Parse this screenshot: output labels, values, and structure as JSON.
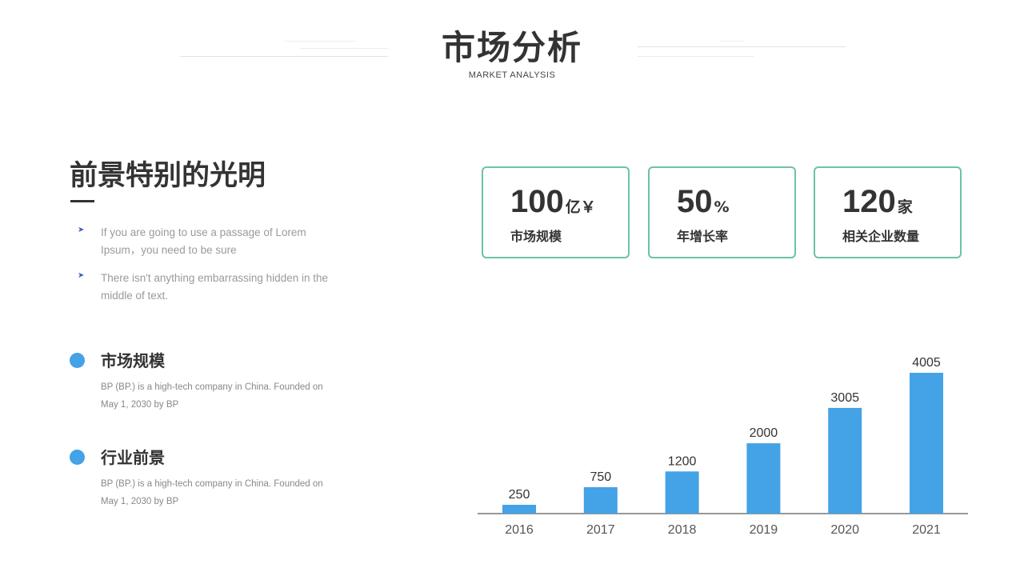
{
  "header": {
    "title": "市场分析",
    "subtitle": "MARKET ANALYSIS"
  },
  "left": {
    "section_title": "前景特别的光明",
    "bullets": [
      "If you are going to use a passage of Lorem Ipsum，you need to be sure",
      "There isn't anything embarrassing hidden in the middle  of text."
    ],
    "items": [
      {
        "title": "市场规模",
        "desc": "BP (BP.) is a high-tech company in China. Founded on May  1, 2030 by BP"
      },
      {
        "title": "行业前景",
        "desc": "BP (BP.) is a high-tech company in China. Founded on May  1, 2030 by BP"
      }
    ]
  },
  "stats": [
    {
      "value": "100",
      "unit": "亿￥",
      "label": "市场规模"
    },
    {
      "value": "50",
      "unit": "%",
      "label": "年增长率"
    },
    {
      "value": "120",
      "unit": "家",
      "label": "相关企业数量"
    }
  ],
  "colors": {
    "bar": "#44a2e6",
    "accent_border": "#6cc4a4",
    "dot": "#44a2e6",
    "text_dark": "#333333",
    "text_muted": "#9a9a9a"
  },
  "icons": {
    "bullet": "arrowhead-icon",
    "item": "circle-dot-icon"
  },
  "chart_data": {
    "type": "bar",
    "categories": [
      "2016",
      "2017",
      "2018",
      "2019",
      "2020",
      "2021"
    ],
    "values": [
      250,
      750,
      1200,
      2000,
      3005,
      4005
    ],
    "data_labels": [
      "250",
      "750",
      "1200",
      "2000",
      "3005",
      "4005"
    ],
    "title": "",
    "xlabel": "",
    "ylabel": "",
    "ylim": [
      0,
      4005
    ],
    "grid": false,
    "legend": "none"
  }
}
